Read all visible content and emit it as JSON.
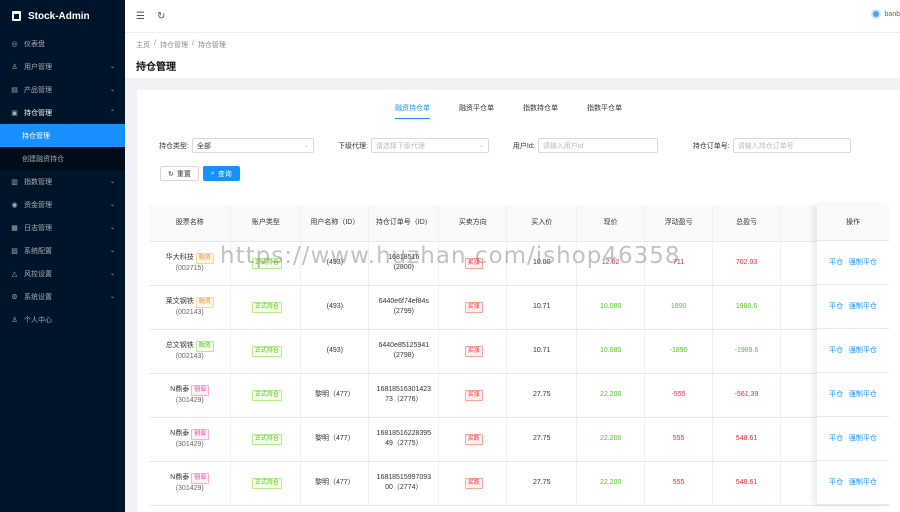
{
  "app": {
    "title": "Stock-Admin"
  },
  "sidebar": {
    "items": [
      {
        "label": "仪表盘",
        "icon": "dashboard-icon"
      },
      {
        "label": "用户管理",
        "icon": "user-icon"
      },
      {
        "label": "产品管理",
        "icon": "product-icon"
      },
      {
        "label": "持仓管理",
        "icon": "briefcase-icon"
      },
      {
        "label": "持仓管理",
        "icon": ""
      },
      {
        "label": "创建融资持仓",
        "icon": ""
      },
      {
        "label": "指数管理",
        "icon": "chart-icon"
      },
      {
        "label": "资金管理",
        "icon": "money-icon"
      },
      {
        "label": "日志管理",
        "icon": "log-icon"
      },
      {
        "label": "系统配置",
        "icon": "settings-icon"
      },
      {
        "label": "风控设置",
        "icon": "warning-icon"
      },
      {
        "label": "系统设置",
        "icon": "gear-icon"
      },
      {
        "label": "个人中心",
        "icon": "person-icon"
      }
    ]
  },
  "header": {
    "username": "banbo"
  },
  "breadcrumb": [
    "主页",
    "/",
    "持仓管理",
    "/",
    "持仓管理"
  ],
  "page_title": "持仓管理",
  "tabs": [
    "融资持仓单",
    "融资平仓单",
    "指数持仓单",
    "指数平仓单"
  ],
  "filters": {
    "type_label": "持仓类型:",
    "type_value": "全部",
    "agent_label": "下级代理:",
    "agent_placeholder": "请选择下级代理",
    "user_label": "用户Id:",
    "user_placeholder": "请输入用户id",
    "order_label": "持仓订单号:",
    "order_placeholder": "请输入持仓订单号"
  },
  "buttons": {
    "reset": "重置",
    "search": "查询"
  },
  "columns": [
    "股票名称",
    "账户类型",
    "用户名称（ID）",
    "持仓订单号（ID）",
    "买卖方向",
    "买入价",
    "现价",
    "浮动盈亏",
    "总盈亏",
    "操作"
  ],
  "rows": [
    {
      "name": "华大科技",
      "code": "(002715)",
      "tag": "融资",
      "tagc": "t-orange",
      "acct": "正式持仓",
      "user": "(493)",
      "order1": "16818516",
      "order2": "(2800)",
      "dir": "买涨",
      "buy": "10.00",
      "now": "12.02",
      "nowc": "r",
      "float": "711",
      "floatc": "r",
      "total": "702.03",
      "totalc": "r"
    },
    {
      "name": "莱文钢铁",
      "code": "(002143)",
      "tag": "融资",
      "tagc": "t-orange",
      "acct": "正式持仓",
      "user": "(493)",
      "order1": "6440e6f74ef84s",
      "order2": "(2799)",
      "dir": "买涨",
      "buy": "10.71",
      "now": "10.080",
      "nowc": "g",
      "float": "1890",
      "floatc": "g",
      "total": "1980.6",
      "totalc": "g"
    },
    {
      "name": "总文钢铁",
      "code": "(002143)",
      "tag": "融资",
      "tagc": "t-green",
      "acct": "正式持仓",
      "user": "(493)",
      "order1": "6440e85125941",
      "order2": "(2798)",
      "dir": "买涨",
      "buy": "10.71",
      "now": "10.080",
      "nowc": "g",
      "float": "-1890",
      "floatc": "g",
      "total": "-1989.6",
      "totalc": "g"
    },
    {
      "name": "N鼎泰",
      "code": "(301429)",
      "tag": "创业",
      "tagc": "t-pink",
      "acct": "正式持仓",
      "user": "黎明（477）",
      "order1": "16818516301423",
      "order2": "73（2776）",
      "dir": "买涨",
      "buy": "27.75",
      "now": "22.200",
      "nowc": "g",
      "float": "-555",
      "floatc": "r",
      "total": "-561.39",
      "totalc": "r"
    },
    {
      "name": "N鼎泰",
      "code": "(301429)",
      "tag": "创业",
      "tagc": "t-pink",
      "acct": "正式持仓",
      "user": "黎明（477）",
      "order1": "16818516228395",
      "order2": "49（2775）",
      "dir": "买跌",
      "buy": "27.75",
      "now": "22.200",
      "nowc": "g",
      "float": "555",
      "floatc": "r",
      "total": "548.61",
      "totalc": "r"
    },
    {
      "name": "N鼎泰",
      "code": "(301429)",
      "tag": "创业",
      "tagc": "t-pink",
      "acct": "正式持仓",
      "user": "黎明（477）",
      "order1": "16818515997093",
      "order2": "00（2774）",
      "dir": "买跌",
      "buy": "27.75",
      "now": "22.200",
      "nowc": "g",
      "float": "555",
      "floatc": "r",
      "total": "548.61",
      "totalc": "r"
    }
  ],
  "ops": {
    "sell": "平仓",
    "lock": "强制平仓"
  },
  "watermark": "https://www.huzhan.com/ishop46358",
  "colors": {
    "sidebar": "#001529",
    "accent": "#1890ff",
    "up": "#f5222d",
    "down": "#52c41a"
  }
}
